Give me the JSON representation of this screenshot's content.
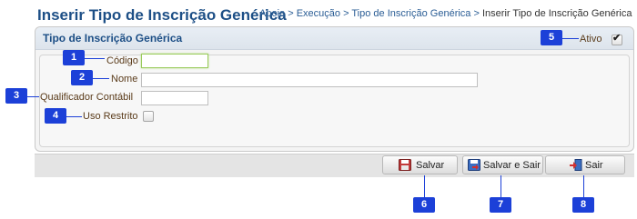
{
  "header": {
    "title": "Inserir Tipo de Inscrição Genérica",
    "breadcrumb": [
      "Apoio",
      "Execução",
      "Tipo de Inscrição Genérica",
      "Inserir Tipo de Inscrição Genérica"
    ],
    "breadcrumb_separator": ">"
  },
  "panel": {
    "title": "Tipo de Inscrição Genérica",
    "ativo_label": "Ativo",
    "ativo_checked": true
  },
  "form": {
    "codigo": {
      "label": "Código",
      "value": "",
      "focused": true
    },
    "nome": {
      "label": "Nome",
      "value": ""
    },
    "qualificador": {
      "label": "Qualificador Contábil",
      "value": ""
    },
    "uso_restrito": {
      "label": "Uso Restrito",
      "checked": false
    }
  },
  "toolbar": {
    "save_label": "Salvar",
    "save_exit_label": "Salvar e Sair",
    "exit_label": "Sair"
  },
  "callouts": [
    "1",
    "2",
    "3",
    "4",
    "5",
    "6",
    "7",
    "8"
  ],
  "colors": {
    "title": "#1d4f86",
    "callout": "#1c40d8",
    "label": "#5a3b1a"
  }
}
